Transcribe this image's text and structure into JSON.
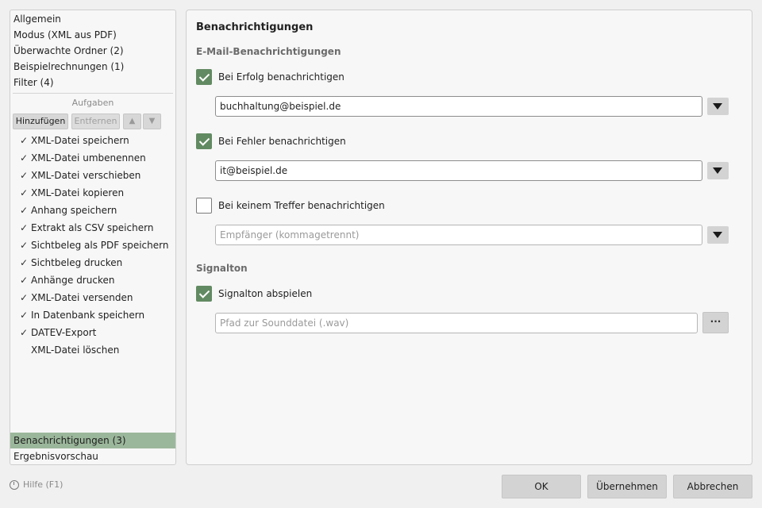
{
  "nav": {
    "top_items": [
      "Allgemein",
      "Modus (XML aus PDF)",
      "Überwachte Ordner (2)",
      "Beispielrechnungen (1)",
      "Filter (4)"
    ],
    "tasks_caption": "Aufgaben",
    "add_label": "Hinzufügen",
    "remove_label": "Entfernen",
    "up_arrow": "▲",
    "down_arrow": "▼",
    "tasks": [
      {
        "label": "XML-Datei speichern",
        "check": "✓"
      },
      {
        "label": "XML-Datei umbenennen",
        "check": "✓"
      },
      {
        "label": "XML-Datei verschieben",
        "check": "✓"
      },
      {
        "label": "XML-Datei kopieren",
        "check": "✓"
      },
      {
        "label": "Anhang speichern",
        "check": "✓"
      },
      {
        "label": "Extrakt als CSV speichern",
        "check": "✓"
      },
      {
        "label": "Sichtbeleg als PDF speichern",
        "check": "✓"
      },
      {
        "label": "Sichtbeleg drucken",
        "check": "✓"
      },
      {
        "label": "Anhänge drucken",
        "check": "✓"
      },
      {
        "label": "XML-Datei versenden",
        "check": "✓"
      },
      {
        "label": "In Datenbank speichern",
        "check": "✓"
      },
      {
        "label": "DATEV-Export",
        "check": "✓"
      },
      {
        "label": "XML-Datei löschen",
        "check": ""
      }
    ],
    "bottom_items": [
      "Benachrichtigungen (3)",
      "Ergebnisvorschau"
    ],
    "selected_color": "#9bb79b"
  },
  "main": {
    "title": "Benachrichtigungen",
    "email_section": "E-Mail-Benachrichtigungen",
    "success": {
      "label": "Bei Erfolg benachrichtigen",
      "checked": true,
      "value": "buchhaltung@beispiel.de"
    },
    "error": {
      "label": "Bei Fehler benachrichtigen",
      "checked": true,
      "value": "it@beispiel.de"
    },
    "no_match": {
      "label": "Bei keinem Treffer benachrichtigen",
      "checked": false,
      "placeholder": "Empfänger (kommagetrennt)"
    },
    "sound_section": "Signalton",
    "sound": {
      "label": "Signalton abspielen",
      "checked": true,
      "placeholder": "Pfad zur Sounddatei (.wav)",
      "browse_label": "···"
    },
    "checkbox_color": "#628a62"
  },
  "footer": {
    "help_label": "Hilfe (F1)",
    "ok_label": "OK",
    "apply_label": "Übernehmen",
    "cancel_label": "Abbrechen"
  }
}
